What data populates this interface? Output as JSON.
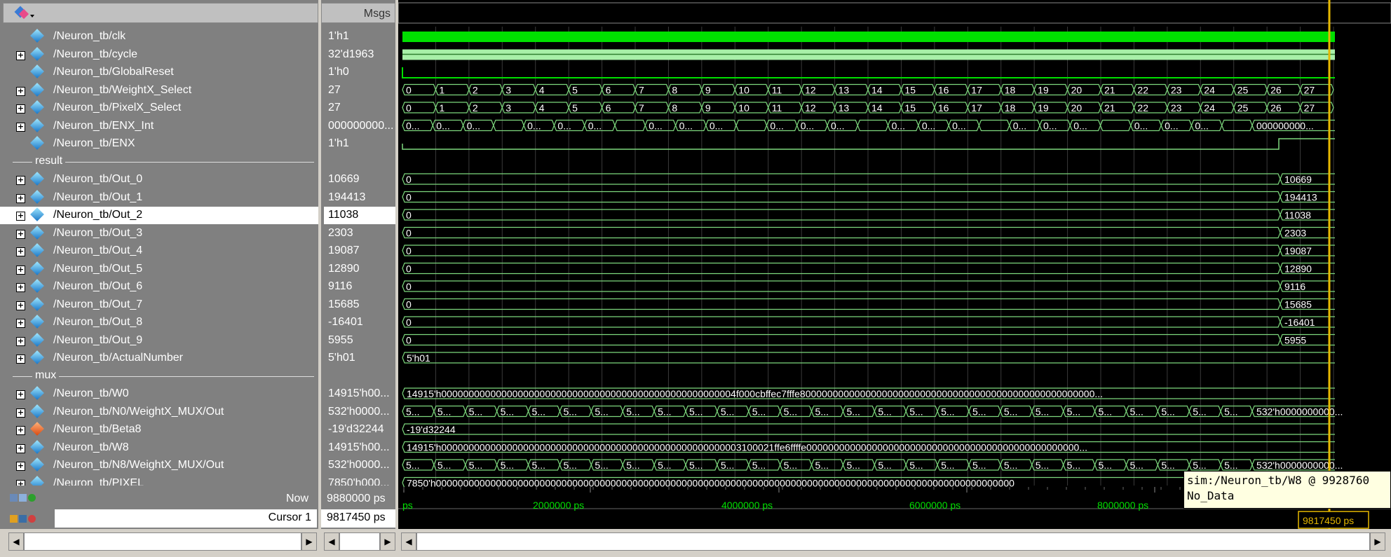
{
  "header": {
    "msgs_label": "Msgs"
  },
  "signals": [
    {
      "name": "/Neuron_tb/clk",
      "value": "1'h1",
      "expand": false,
      "icon": "signal-diamond-icon"
    },
    {
      "name": "/Neuron_tb/cycle",
      "value": "32'd1963",
      "expand": true,
      "icon": "signal-diamond-icon"
    },
    {
      "name": "/Neuron_tb/GlobalReset",
      "value": "1'h0",
      "expand": false,
      "icon": "signal-diamond-icon"
    },
    {
      "name": "/Neuron_tb/WeightX_Select",
      "value": "27",
      "expand": true,
      "icon": "signal-diamond-icon"
    },
    {
      "name": "/Neuron_tb/PixelX_Select",
      "value": "27",
      "expand": true,
      "icon": "signal-diamond-icon"
    },
    {
      "name": "/Neuron_tb/ENX_Int",
      "value": "000000000...",
      "expand": true,
      "icon": "signal-diamond-icon"
    },
    {
      "name": "/Neuron_tb/ENX",
      "value": "1'h1",
      "expand": false,
      "icon": "signal-diamond-icon"
    },
    {
      "group": "result"
    },
    {
      "name": "/Neuron_tb/Out_0",
      "value": "10669",
      "expand": true,
      "icon": "signal-diamond-icon",
      "final": "10669"
    },
    {
      "name": "/Neuron_tb/Out_1",
      "value": "194413",
      "expand": true,
      "icon": "signal-diamond-icon",
      "final": "194413"
    },
    {
      "name": "/Neuron_tb/Out_2",
      "value": "11038",
      "expand": true,
      "icon": "signal-diamond-icon",
      "final": "11038",
      "selected": true
    },
    {
      "name": "/Neuron_tb/Out_3",
      "value": "2303",
      "expand": true,
      "icon": "signal-diamond-icon",
      "final": "2303"
    },
    {
      "name": "/Neuron_tb/Out_4",
      "value": "19087",
      "expand": true,
      "icon": "signal-diamond-icon",
      "final": "19087"
    },
    {
      "name": "/Neuron_tb/Out_5",
      "value": "12890",
      "expand": true,
      "icon": "signal-diamond-icon",
      "final": "12890"
    },
    {
      "name": "/Neuron_tb/Out_6",
      "value": "9116",
      "expand": true,
      "icon": "signal-diamond-icon",
      "final": "9116"
    },
    {
      "name": "/Neuron_tb/Out_7",
      "value": "15685",
      "expand": true,
      "icon": "signal-diamond-icon",
      "final": "15685"
    },
    {
      "name": "/Neuron_tb/Out_8",
      "value": "-16401",
      "expand": true,
      "icon": "signal-diamond-icon",
      "final": "-16401"
    },
    {
      "name": "/Neuron_tb/Out_9",
      "value": "5955",
      "expand": true,
      "icon": "signal-diamond-icon",
      "final": "5955"
    },
    {
      "name": "/Neuron_tb/ActualNumber",
      "value": "5'h01",
      "expand": true,
      "icon": "signal-diamond-icon"
    },
    {
      "group": "mux"
    },
    {
      "name": "/Neuron_tb/W0",
      "value": "14915'h00...",
      "expand": true,
      "icon": "signal-diamond-icon"
    },
    {
      "name": "/Neuron_tb/N0/WeightX_MUX/Out",
      "value": "532'h0000...",
      "expand": true,
      "icon": "port-out-icon"
    },
    {
      "name": "/Neuron_tb/Beta8",
      "value": "-19'd32244",
      "expand": true,
      "icon": "constant-diamond-icon"
    },
    {
      "name": "/Neuron_tb/W8",
      "value": "14915'h00...",
      "expand": true,
      "icon": "signal-diamond-icon"
    },
    {
      "name": "/Neuron_tb/N8/WeightX_MUX/Out",
      "value": "532'h0000...",
      "expand": true,
      "icon": "port-out-icon"
    },
    {
      "name": "/Neuron_tb/PIXEL",
      "value": "7850'h000...",
      "expand": true,
      "icon": "signal-diamond-icon"
    }
  ],
  "waves": {
    "select_labels": [
      "0",
      "1",
      "2",
      "3",
      "4",
      "5",
      "6",
      "7",
      "8",
      "9",
      "10",
      "11",
      "12",
      "13",
      "14",
      "15",
      "16",
      "17",
      "18",
      "19",
      "20",
      "21",
      "22",
      "23",
      "24",
      "25",
      "26",
      "27"
    ],
    "enx_int_labels": [
      "0...",
      "0...",
      "0...",
      "",
      "0...",
      "0...",
      "0...",
      "",
      "0...",
      "0...",
      "0...",
      "",
      "0...",
      "0...",
      "0...",
      "",
      "0...",
      "0...",
      "0...",
      "",
      "0...",
      "0...",
      "0...",
      "",
      "0...",
      "0...",
      "0...",
      ""
    ],
    "enx_int_final": "000000000...",
    "out_initial": "0",
    "actual_number": "5'h01",
    "w0_text": "14915'h000000000000000000000000000000000000000000000000000004f000cbffec7fffe800000000000000000000000000000000000000000000000000000...",
    "w8_text": "14915'h0000000000000000000000000000000000000000000000000000003100021ffe6ffffe00000000000000000000000000000000000000000000000000...",
    "mux_label": "5...",
    "mux_final": "532'h0000000000...",
    "beta8": "-19'd32244",
    "pixel_text": "7850'h0000000000000000000000000000000000000000000000000000000000000000000000000000000000000000000000000000000000"
  },
  "footer": {
    "now_label": "Now",
    "now_value": "9880000 ps",
    "cursor_label": "Cursor 1",
    "cursor_value": "9817450 ps",
    "ticks": [
      "ps",
      "2000000 ps",
      "4000000 ps",
      "6000000 ps",
      "8000000 ps"
    ],
    "cursor_flag": "9817450 ps"
  },
  "tooltip": {
    "line1": "sim:/Neuron_tb/W8 @ 9928760",
    "line2": "No_Data"
  },
  "colors": {
    "clk": "#00e000",
    "cycle": "#a8f0a8",
    "wave": "#7dd87d",
    "cursor": "#e6b800",
    "gridline": "#3a3a3a"
  }
}
